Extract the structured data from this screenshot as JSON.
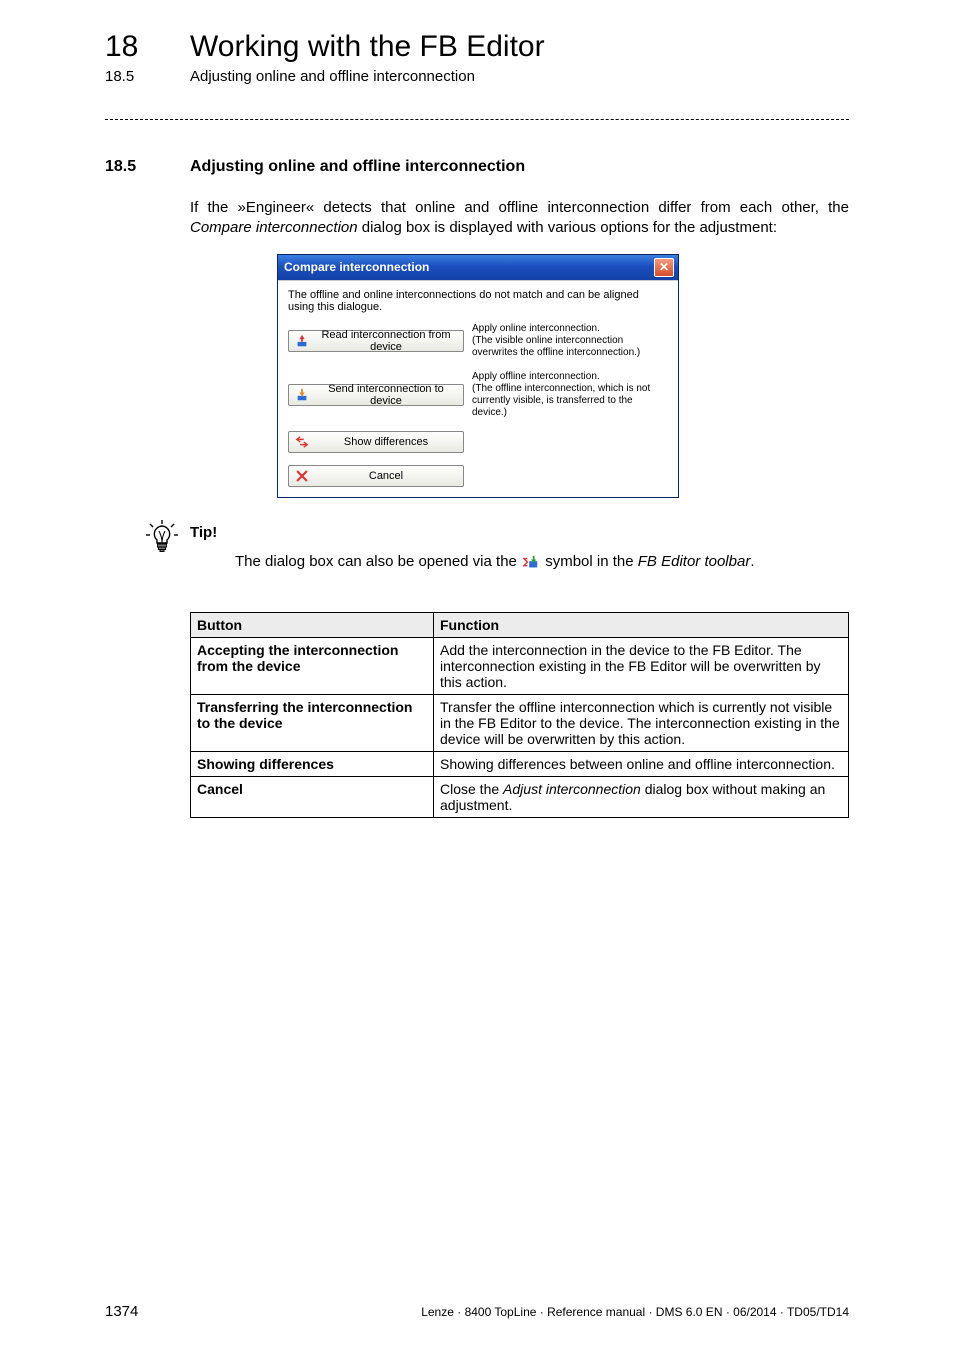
{
  "header": {
    "chapter_number": "18",
    "chapter_title": "Working with the FB Editor",
    "section_number_small": "18.5",
    "section_title_small": "Adjusting online and offline interconnection"
  },
  "section": {
    "number": "18.5",
    "title": "Adjusting online and offline interconnection",
    "intro_a": "If the »Engineer« detects that online and offline interconnection differ from each other, the ",
    "intro_em": "Compare interconnection",
    "intro_b": " dialog box is displayed with various options for the adjustment:"
  },
  "dialog": {
    "title": "Compare interconnection",
    "instruction": "The offline and online interconnections do not match and can be aligned using this dialogue.",
    "rows": [
      {
        "button_label": "Read interconnection from device",
        "icon": "upload-icon",
        "desc": "Apply online interconnection.\n(The visible online interconnection overwrites the offline interconnection.)"
      },
      {
        "button_label": "Send interconnection to device",
        "icon": "download-icon",
        "desc": "Apply offline interconnection.\n(The offline interconnection, which is not currently visible, is transferred to the device.)"
      },
      {
        "button_label": "Show differences",
        "icon": "diff-icon",
        "desc": ""
      },
      {
        "button_label": "Cancel",
        "icon": "cancel-icon",
        "desc": ""
      }
    ]
  },
  "tip": {
    "label": "Tip!",
    "body_a": "The dialog box can also be opened via the ",
    "body_b": " symbol in the ",
    "body_em": "FB Editor toolbar",
    "body_c": "."
  },
  "table": {
    "headers": [
      "Button",
      "Function"
    ],
    "rows": [
      {
        "c1": "Accepting the interconnection from the device",
        "c2": "Add the interconnection in the device to the FB Editor. The interconnection existing in the FB Editor will be overwritten by this action."
      },
      {
        "c1": "Transferring the interconnection to the device",
        "c2": "Transfer the offline interconnection which is currently not visible in the FB Editor to the device. The interconnection existing in the device will be overwritten by this action."
      },
      {
        "c1": "Showing differences",
        "c2": "Showing differences between online and offline interconnection."
      },
      {
        "c1": "Cancel",
        "c2_a": "Close the ",
        "c2_em": "Adjust interconnection",
        "c2_b": " dialog box without making an adjustment."
      }
    ]
  },
  "footer": {
    "page": "1374",
    "info": "Lenze · 8400 TopLine · Reference manual · DMS 6.0 EN · 06/2014 · TD05/TD14"
  }
}
